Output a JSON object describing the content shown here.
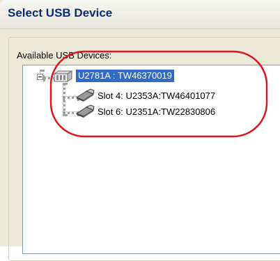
{
  "window": {
    "title": "Select USB Device"
  },
  "group": {
    "label": "Available USB Devices:"
  },
  "tree": {
    "root": {
      "label": "U2781A : TW46370019",
      "icon": "chassis-icon",
      "expanded": true,
      "selected": true
    },
    "children": [
      {
        "label": "Slot 4: U2353A:TW46401077",
        "icon": "usb-module-icon"
      },
      {
        "label": "Slot 6: U2351A:TW22830806",
        "icon": "usb-module-icon"
      }
    ]
  },
  "colors": {
    "selection": "#316ac5",
    "title_text": "#0c2b7a",
    "annotation": "#e0141e"
  }
}
